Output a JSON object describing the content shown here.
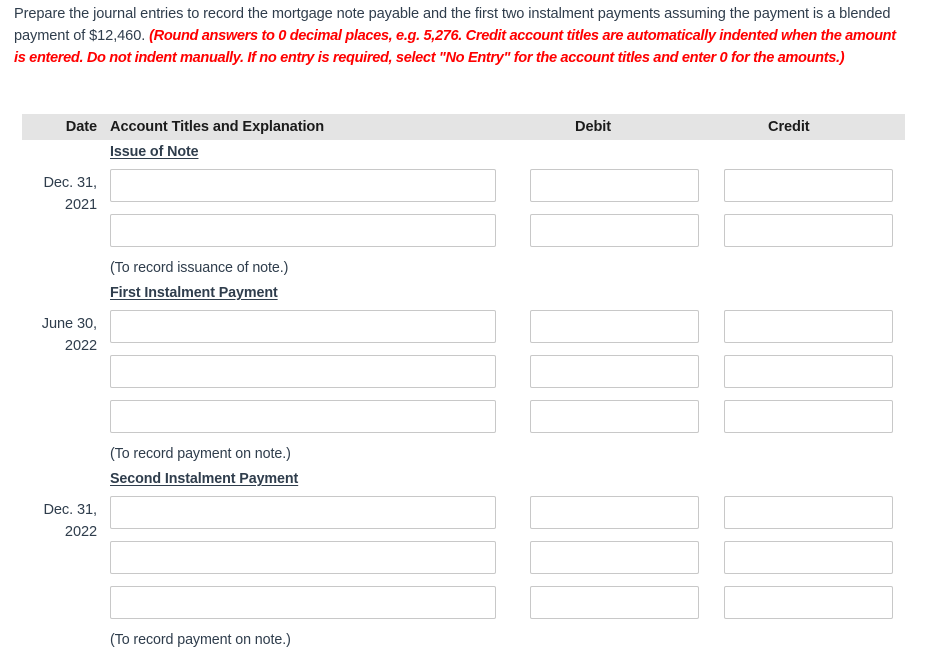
{
  "instructions": {
    "main_text": "Prepare the journal entries to record the mortgage note payable and the first two instalment payments assuming the payment is a blended payment of $12,460. ",
    "note_text": "(Round answers to 0 decimal places, e.g. 5,276. Credit account titles are automatically indented when the amount is entered. Do not indent manually. If no entry is required, select \"No Entry\" for the account titles and enter 0 for the amounts.)",
    "note_color": "#ff0000"
  },
  "table": {
    "headers": {
      "date": "Date",
      "account": "Account Titles and Explanation",
      "debit": "Debit",
      "credit": "Credit"
    },
    "header_background": "#e4e4e4",
    "sections": [
      {
        "title": "Issue of Note",
        "date": "Dec. 31, 2021",
        "date_line1": "Dec. 31,",
        "date_line2": "2021",
        "rows": [
          {
            "account": "",
            "debit": "",
            "credit": ""
          },
          {
            "account": "",
            "debit": "",
            "credit": ""
          }
        ],
        "caption": "(To record issuance of note.)"
      },
      {
        "title": "First Instalment Payment",
        "date": "June 30, 2022",
        "date_line1": "June 30,",
        "date_line2": "2022",
        "rows": [
          {
            "account": "",
            "debit": "",
            "credit": ""
          },
          {
            "account": "",
            "debit": "",
            "credit": ""
          },
          {
            "account": "",
            "debit": "",
            "credit": ""
          }
        ],
        "caption": "(To record payment on note.)"
      },
      {
        "title": "Second Instalment Payment",
        "date": "Dec. 31, 2022",
        "date_line1": "Dec. 31,",
        "date_line2": "2022",
        "rows": [
          {
            "account": "",
            "debit": "",
            "credit": ""
          },
          {
            "account": "",
            "debit": "",
            "credit": ""
          },
          {
            "account": "",
            "debit": "",
            "credit": ""
          }
        ],
        "caption": "(To record payment on note.)"
      }
    ]
  }
}
